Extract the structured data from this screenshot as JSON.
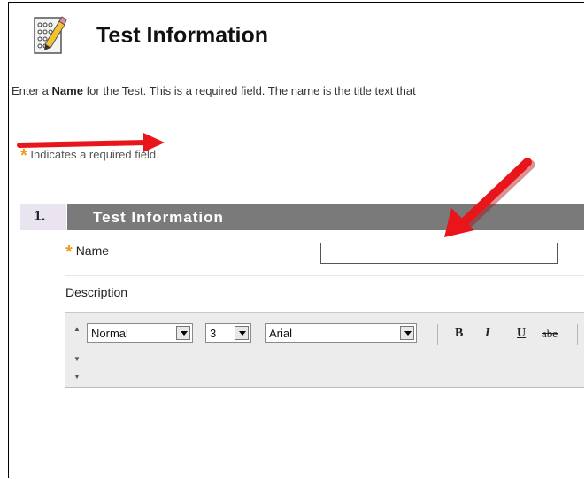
{
  "page": {
    "title": "Test Information",
    "instructions_pre": "Enter a ",
    "instructions_bold": "Name",
    "instructions_post": " for the Test. This is a required field. The name is the title text that",
    "required_star": "*",
    "required_note": "Indicates a required field."
  },
  "section": {
    "number": "1.",
    "title": "Test Information"
  },
  "form": {
    "name_star": "*",
    "name_label": "Name",
    "name_value": "",
    "description_label": "Description"
  },
  "editor": {
    "paragraph_style": "Normal",
    "font_size": "3",
    "font_family": "Arial",
    "bold": "B",
    "italic": "I",
    "underline": "U",
    "strikethrough": "abe",
    "body_text": ""
  },
  "annotations": {
    "arrow_color": "#e8151b"
  },
  "icons": {
    "page_icon": "test-checklist-icon",
    "collapse": "triangle-up-icon",
    "expand": "triangle-down-icon"
  }
}
